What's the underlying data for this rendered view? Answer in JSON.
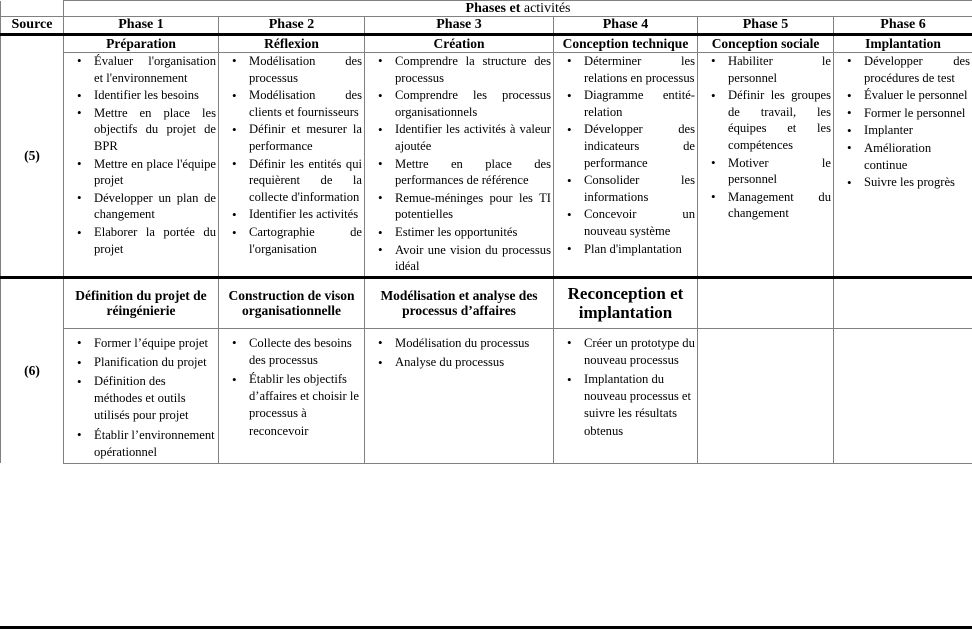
{
  "header": {
    "banner_bold": "Phases et",
    "banner_regular": " activités",
    "source_label": "Source",
    "phases": [
      "Phase 1",
      "Phase 2",
      "Phase 3",
      "Phase 4",
      "Phase 5",
      "Phase 6"
    ]
  },
  "rows": [
    {
      "source": "(5)",
      "subtitles": [
        "Préparation",
        "Réflexion",
        "Création",
        "Conception technique",
        "Conception sociale",
        "Implantation"
      ],
      "columns": [
        [
          "Évaluer l'organisation et l'environnement",
          "Identifier les besoins",
          "Mettre en place les objectifs du projet de BPR",
          "Mettre en place l'équipe projet",
          "Développer un plan de changement",
          "Elaborer la portée du projet"
        ],
        [
          "Modélisation des processus",
          "Modélisation des clients et fournisseurs",
          "Définir et mesurer la performance",
          "Définir les entités qui requièrent de la collecte d'information",
          "Identifier les activités",
          "Cartographie de l'organisation"
        ],
        [
          "Comprendre la structure des processus",
          "Comprendre les processus organisationnels",
          "Identifier les activités à valeur ajoutée",
          "Mettre en place des performances de référence",
          "Remue-méninges pour les TI potentielles",
          "Estimer les opportunités",
          "Avoir une vision du processus idéal"
        ],
        [
          "Déterminer les relations en processus",
          "Diagramme entité-relation",
          "Développer des indicateurs de performance",
          "Consolider les informations",
          "Concevoir un nouveau système",
          "Plan d'implantation"
        ],
        [
          "Habiliter le personnel",
          "Définir les groupes de travail, les équipes et les compétences",
          "Motiver le personnel",
          "Management du changement"
        ],
        [
          "Développer des procédures de test",
          "Évaluer le personnel",
          "Former le personnel",
          "Implanter",
          "Amélioration continue",
          "Suivre les progrès"
        ]
      ]
    },
    {
      "source": "(6)",
      "subtitles": [
        "Définition du projet de réingénierie",
        "Construction de vison organisationnelle",
        "Modélisation et analyse des processus d’affaires",
        "Reconception et implantation",
        "",
        ""
      ],
      "columns": [
        [
          "Former l’équipe projet",
          "Planification du projet",
          "Définition des méthodes et outils utilisés pour projet",
          "Établir l’environnement opérationnel"
        ],
        [
          "Collecte des besoins des processus",
          "Établir les objectifs d’affaires et choisir le processus à reconcevoir"
        ],
        [
          "Modélisation du processus",
          "Analyse du processus"
        ],
        [
          "Créer un prototype du nouveau processus",
          "Implantation du nouveau processus et suivre les résultats obtenus"
        ],
        [],
        []
      ]
    }
  ]
}
